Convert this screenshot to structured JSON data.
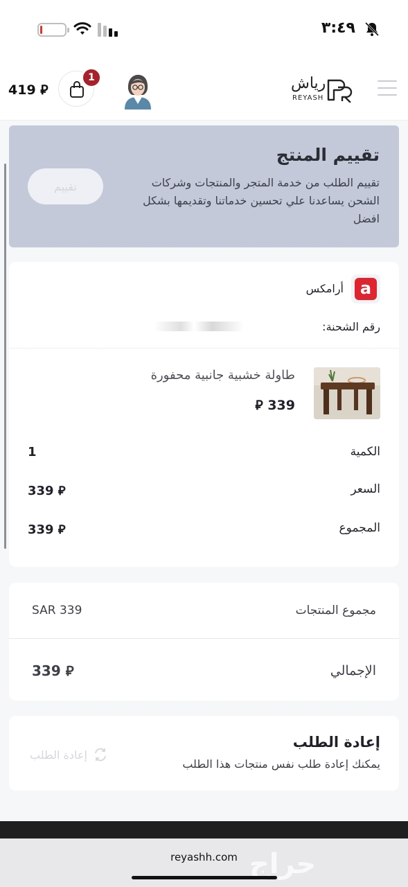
{
  "status_bar": {
    "time": "٣:٤٩",
    "battery_level": 0.08
  },
  "header": {
    "brand_name": "رياش",
    "brand_latin": "REYASH",
    "cart_count": "1",
    "balance": "419 ⃁"
  },
  "rating": {
    "title": "تقييم المنتج",
    "description": "تقييم الطلب من خدمة المتجر والمنتجات وشركات الشحن يساعدنا علي تحسين خدماتنا وتقديمها بشكل افضل",
    "button_label": "تقييم"
  },
  "shipment": {
    "carrier_name": "أرامكس",
    "carrier_logo_letter": "a",
    "tracking_label": "رقم الشحنة:"
  },
  "item": {
    "name": "طاولة خشبية جانبية محفورة",
    "price": "339 ⃁",
    "quantity_label": "الكمية",
    "quantity_value": "1",
    "price_label": "السعر",
    "price_value": "339 ⃁",
    "total_label": "المجموع",
    "total_value": "339 ⃁"
  },
  "totals": {
    "subtotal_label": "مجموع المنتجات",
    "subtotal_value": "SAR 339",
    "grand_label": "الإجمالي",
    "grand_value": "339 ⃁"
  },
  "reorder": {
    "title": "إعادة الطلب",
    "description": "يمكنك إعادة طلب نفس منتجات هذا الطلب",
    "button_label": "إعادة الطلب"
  },
  "browser": {
    "url": "reyashh.com",
    "watermark": "حراج"
  },
  "colors": {
    "rating_banner": "#c3c9d8",
    "cart_badge": "#a8202a",
    "carrier_red": "#e0242f"
  }
}
